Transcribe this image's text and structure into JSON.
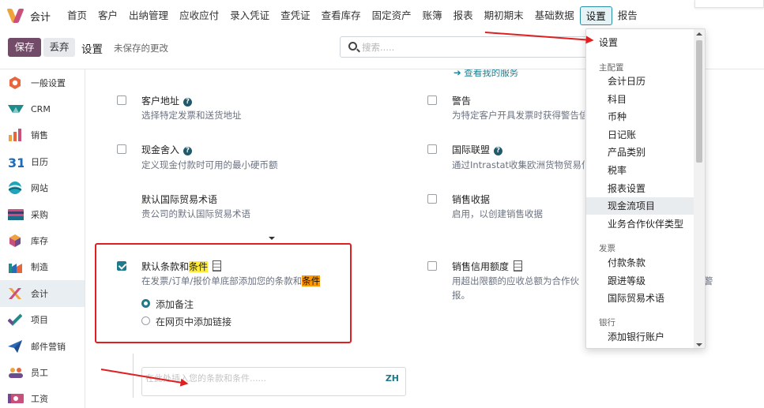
{
  "topnav": {
    "app_name": "会计",
    "items": [
      "首页",
      "客户",
      "出纳管理",
      "应收应付",
      "录入凭证",
      "查凭证",
      "查看库存",
      "固定资产",
      "账簿",
      "报表",
      "期初期末",
      "基础数据",
      "设置",
      "报告"
    ],
    "active_index": 12
  },
  "control": {
    "save": "保存",
    "discard": "丢弃",
    "title": "设置",
    "unsaved": "未保存的更改",
    "search_placeholder": "搜索....."
  },
  "sidebar": {
    "items": [
      {
        "label": "一般设置",
        "icon": "gear-icon"
      },
      {
        "label": "CRM",
        "icon": "crm-icon"
      },
      {
        "label": "销售",
        "icon": "sales-chart-icon"
      },
      {
        "label": "日历",
        "icon": "calendar-icon"
      },
      {
        "label": "网站",
        "icon": "globe-icon"
      },
      {
        "label": "采购",
        "icon": "card-icon"
      },
      {
        "label": "库存",
        "icon": "box-icon"
      },
      {
        "label": "制造",
        "icon": "factory-icon"
      },
      {
        "label": "会计",
        "icon": "accounting-icon"
      },
      {
        "label": "项目",
        "icon": "check-icon"
      },
      {
        "label": "邮件营销",
        "icon": "paper-plane-icon"
      },
      {
        "label": "员工",
        "icon": "people-icon"
      },
      {
        "label": "工资",
        "icon": "payroll-icon"
      }
    ],
    "active_index": 8
  },
  "main": {
    "link_service": "➔ 查看我的服务",
    "customer_address": {
      "title": "客户地址",
      "desc": "选择特定发票和送货地址"
    },
    "warning": {
      "title": "警告",
      "desc": "为特定客户开具发票时获得警告信"
    },
    "cash_rounding": {
      "title": "现金舍入",
      "desc": "定义现金付款时可用的最小硬币额"
    },
    "intrastat": {
      "title": "国际联盟",
      "desc": "通过Intrastat收集欧洲货物贸易信"
    },
    "incoterm": {
      "title": "默认国际贸易术语",
      "desc": "贵公司的默认国际贸易术语"
    },
    "sales_receipt": {
      "title": "销售收据",
      "desc": "启用，以创建销售收据"
    },
    "default_terms": {
      "title_prefix": "默认条款和",
      "title_highlight": "条件",
      "desc_prefix": "在发票/订单/报价单底部添加您的条款和",
      "desc_highlight": "条件",
      "checked": true,
      "options": [
        "添加备注",
        "在网页中添加链接"
      ],
      "selected_option": 0
    },
    "credit_limit": {
      "title": "销售信用额度",
      "desc_line1": "用超出限额的应收总额为合作伙",
      "desc_line1_tail": "警",
      "desc_line2": "报。"
    },
    "terms_input": {
      "placeholder": "在此处插入您的条款和条件......",
      "lang": "ZH"
    }
  },
  "menu": {
    "header": "设置",
    "sections": [
      {
        "label": "主配置",
        "items": [
          "会计日历",
          "科目",
          "币种",
          "日记账",
          "产品类别",
          "税率",
          "报表设置",
          "现金流项目",
          "业务合作伙伴类型"
        ]
      },
      {
        "label": "发票",
        "items": [
          "付款条款",
          "跟进等级",
          "国际贸易术语"
        ]
      },
      {
        "label": "银行",
        "items": [
          "添加银行账户"
        ]
      }
    ],
    "hover_item": "现金流项目"
  },
  "colors": {
    "brand": "#714b67",
    "accent": "#1f7a8c",
    "annotation": "#e02020",
    "highlight_yellow": "#ffeb3b",
    "highlight_orange": "#ff9800"
  }
}
